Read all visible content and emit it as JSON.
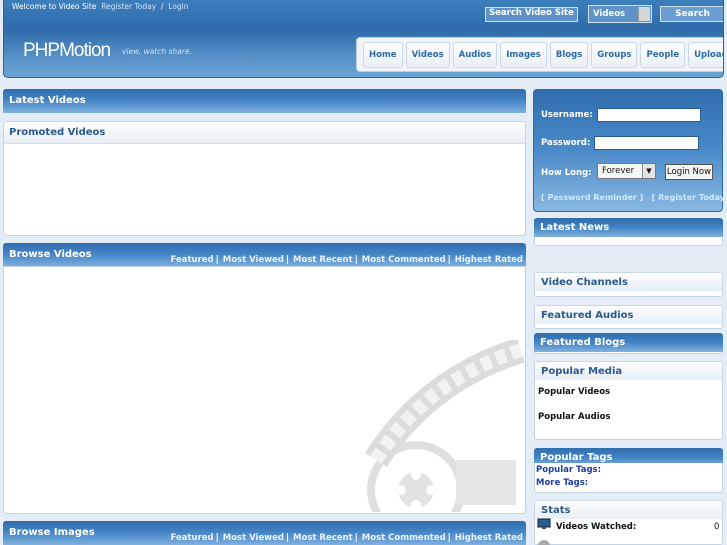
{
  "header": {
    "welcome_text": "Welcome to Video Site",
    "register_link": "Register Today",
    "login_separator": "/",
    "login_link": "Login",
    "logo": "PHPMotion",
    "tagline": "view, watch share.",
    "search_placeholder": "Search Video Site",
    "search_scope": "Videos",
    "search_button": "Search"
  },
  "nav": {
    "items": [
      "Home",
      "Videos",
      "Audios",
      "Images",
      "Blogs",
      "Groups",
      "People",
      "Upload"
    ]
  },
  "main": {
    "latest_videos_title": "Latest Videos",
    "promoted_videos_title": "Promoted Videos",
    "browse_videos_title": "Browse Videos",
    "browse_images_title": "Browse Images",
    "filter_tabs": [
      "Featured",
      "Most Viewed",
      "Most Recent",
      "Most Commented",
      "Highest Rated"
    ],
    "tab_separator": "|"
  },
  "sidebar": {
    "username_label": "Username:",
    "password_label": "Password:",
    "how_long_label": "How Long:",
    "how_long_value": "Forever",
    "login_button": "Login Now",
    "password_reminder": "[ Password Reminder ]",
    "register_today": "[ Register Today ]",
    "latest_news": "Latest News",
    "video_channels": "Video Channels",
    "featured_audios": "Featured Audios",
    "featured_blogs": "Featured Blogs",
    "popular_media": "Popular Media",
    "popular_videos": "Popular Videos",
    "popular_audios": "Popular Audios",
    "popular_tags_title": "Popular Tags",
    "popular_tags_label": "Popular Tags:",
    "more_tags_label": "More Tags:",
    "stats_title": "Stats",
    "videos_watched_label": "Videos Watched:",
    "videos_watched_value": "0"
  },
  "colors": {
    "brand_blue": "#3d7fbd",
    "nav_text": "#2d6aa6",
    "page_bg": "#e4edf5"
  }
}
